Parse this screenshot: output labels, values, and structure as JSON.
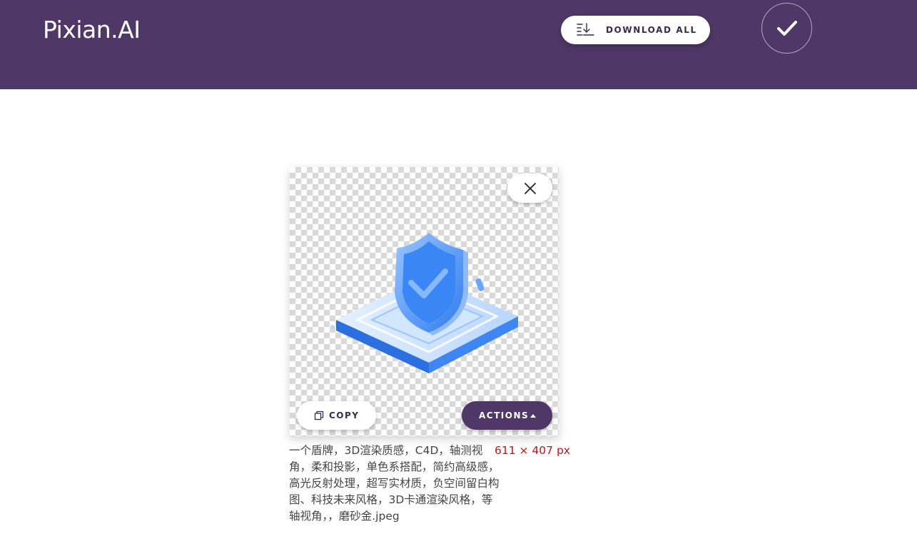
{
  "header": {
    "logo": "Pixian.AI",
    "download_all_label": "DOWNLOAD ALL",
    "download_icon": "download-list-icon",
    "confirm_icon": "checkmark-icon"
  },
  "result_card": {
    "close_icon": "close-icon",
    "copy_label": "COPY",
    "copy_icon": "copy-icon",
    "actions_label": "ACTIONS",
    "actions_caret_icon": "caret-up-icon",
    "filename": "一个盾牌，3D渲染质感，C4D，轴测视角，柔和投影，单色系搭配，简约高级感，高光反射处理，超写实材质，负空间留白构图、科技未来风格，3D卡通渲染风格，等轴视角，，磨砂金.jpeg",
    "dimensions": "611 × 407 px"
  },
  "colors": {
    "brand_purple": "#4f3867",
    "dimension_red": "#c0141c"
  }
}
